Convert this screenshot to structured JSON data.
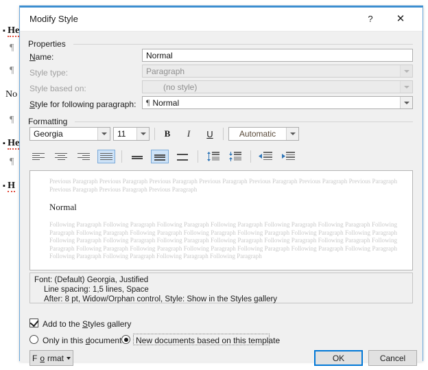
{
  "background_document": {
    "lines": [
      {
        "type": "bullet-heading",
        "text": "He"
      },
      {
        "type": "pilcrow",
        "text": "¶"
      },
      {
        "type": "pilcrow",
        "text": "¶"
      },
      {
        "type": "text",
        "text": "No"
      },
      {
        "type": "pilcrow",
        "text": "¶"
      },
      {
        "type": "bullet-heading",
        "text": "He"
      },
      {
        "type": "pilcrow",
        "text": "¶"
      },
      {
        "type": "bullet-heading",
        "text": "H"
      }
    ],
    "bullet_glyph": "▪"
  },
  "dialog": {
    "title": "Modify Style",
    "help_icon": "?",
    "close_icon": "✕",
    "properties": {
      "group_label": "Properties",
      "name_label": "Name:",
      "name_label_accel": "N",
      "name_value": "Normal",
      "style_type_label": "Style type:",
      "style_type_value": "Paragraph",
      "style_based_on_label": "Style based on:",
      "style_based_on_value": "(no style)",
      "following_label": "Style for following paragraph:",
      "following_label_accel": "S",
      "following_value": "Normal",
      "following_pilcrow": "¶"
    },
    "formatting": {
      "group_label": "Formatting",
      "font_family": "Georgia",
      "font_size": "11",
      "bold_label": "B",
      "italic_label": "I",
      "underline_label": "U",
      "font_color": "Automatic",
      "font_color_hex": "#5a4a3a",
      "align_buttons": [
        {
          "name": "align-left",
          "selected": false
        },
        {
          "name": "align-center",
          "selected": false
        },
        {
          "name": "align-right",
          "selected": false
        },
        {
          "name": "align-justify",
          "selected": true
        }
      ],
      "line_spacing_buttons": [
        {
          "name": "line-spacing-single",
          "selected": false
        },
        {
          "name": "line-spacing-1-5",
          "selected": true
        },
        {
          "name": "line-spacing-double",
          "selected": false
        }
      ],
      "spacing_buttons": [
        {
          "name": "decrease-space-before",
          "selected": false
        },
        {
          "name": "increase-space-after",
          "selected": false
        }
      ],
      "indent_buttons": [
        {
          "name": "decrease-indent",
          "selected": false
        },
        {
          "name": "increase-indent",
          "selected": false
        }
      ]
    },
    "preview": {
      "previous_paragraph_text": "Previous Paragraph Previous Paragraph Previous Paragraph Previous Paragraph Previous Paragraph Previous Paragraph Previous Paragraph Previous Paragraph Previous Paragraph Previous Paragraph",
      "sample_text": "Normal",
      "following_paragraph_text": "Following Paragraph Following Paragraph Following Paragraph Following Paragraph Following Paragraph Following Paragraph Following Paragraph Following Paragraph Following Paragraph Following Paragraph Following Paragraph Following Paragraph Following Paragraph Following Paragraph Following Paragraph Following Paragraph Following Paragraph Following Paragraph Following Paragraph Following Paragraph Following Paragraph Following Paragraph Following Paragraph Following Paragraph Following Paragraph Following Paragraph Following Paragraph Following Paragraph Following Paragraph Following Paragraph"
    },
    "description": {
      "line1": "Font: (Default) Georgia, Justified",
      "line2": "Line spacing:  1,5 lines, Space",
      "line3": "After:  8 pt, Widow/Orphan control, Style: Show in the Styles gallery"
    },
    "options": {
      "add_to_gallery_label": "Add to the Styles gallery",
      "add_to_gallery_accel": "S",
      "add_to_gallery_checked": true,
      "only_this_document_label": "Only in this document",
      "only_this_document_accel": "d",
      "only_this_document_selected": false,
      "new_documents_label": "New documents based on this template",
      "new_documents_selected": true
    },
    "footer": {
      "format_label": "Format",
      "format_accel": "o",
      "ok_label": "OK",
      "cancel_label": "Cancel"
    }
  }
}
